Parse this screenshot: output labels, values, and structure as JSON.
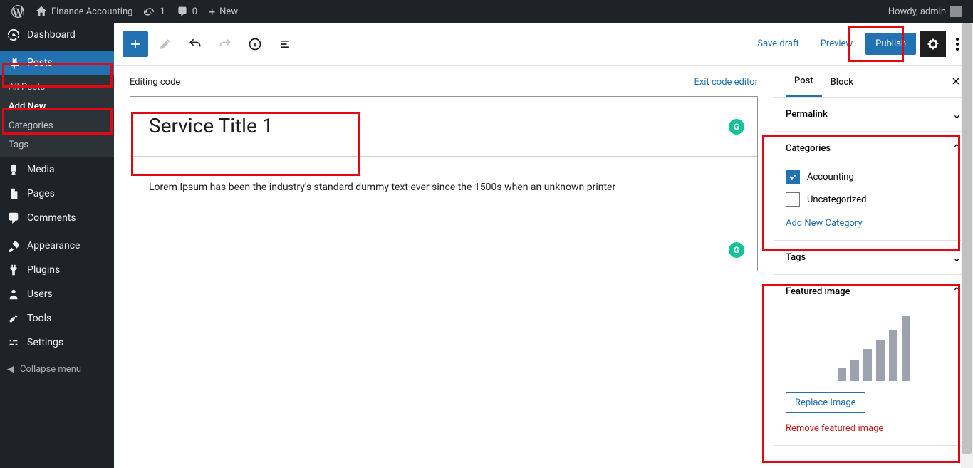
{
  "adminbar": {
    "site_name": "Finance Accounting",
    "updates_count": "1",
    "comments_count": "0",
    "new_label": "New",
    "howdy": "Howdy, admin"
  },
  "sidebar": {
    "dashboard": "Dashboard",
    "posts": "Posts",
    "posts_sub": {
      "all": "All Posts",
      "add": "Add New",
      "categories": "Categories",
      "tags": "Tags"
    },
    "media": "Media",
    "pages": "Pages",
    "comments": "Comments",
    "appearance": "Appearance",
    "plugins": "Plugins",
    "users": "Users",
    "tools": "Tools",
    "settings": "Settings",
    "collapse": "Collapse menu"
  },
  "toolbar": {
    "save_draft": "Save draft",
    "preview": "Preview",
    "publish": "Publish"
  },
  "editor": {
    "editing_code": "Editing code",
    "exit_code": "Exit code editor",
    "title": "Service Title 1",
    "content": "Lorem Ipsum has been the industry's standard dummy text ever since the 1500s when an unknown printer"
  },
  "panel": {
    "tab_post": "Post",
    "tab_block": "Block",
    "permalink": "Permalink",
    "categories": "Categories",
    "cat_items": [
      {
        "label": "Accounting",
        "checked": true
      },
      {
        "label": "Uncategorized",
        "checked": false
      }
    ],
    "add_category": "Add New Category",
    "tags": "Tags",
    "featured_image": "Featured image",
    "replace_image": "Replace Image",
    "remove_image": "Remove featured image"
  }
}
